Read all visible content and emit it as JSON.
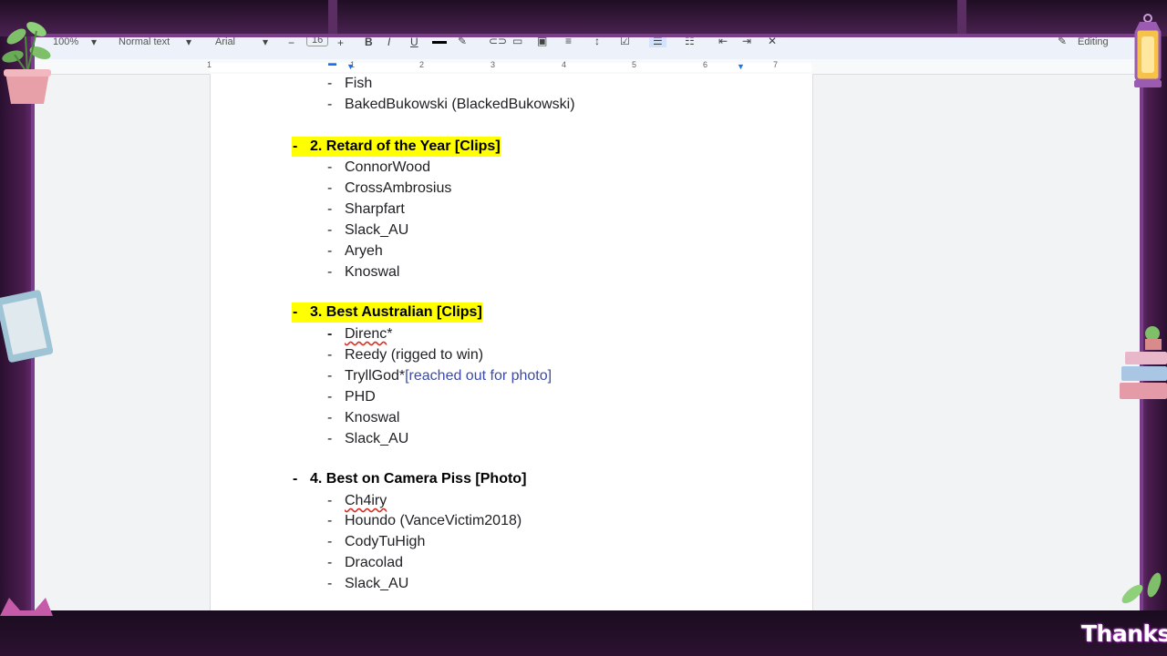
{
  "toolbar": {
    "zoom": "100%",
    "style": "Normal text",
    "font": "Arial",
    "font_size": "16",
    "mode": "Editing"
  },
  "ruler": {
    "numbers": [
      "1",
      "1",
      "2",
      "3",
      "4",
      "5",
      "6",
      "7"
    ]
  },
  "document": {
    "top_items": [
      "Fish",
      "BakedBukowski (BlackedBukowski)"
    ],
    "sections": [
      {
        "heading": "2. Retard of the Year [Clips]",
        "highlighted": true,
        "items": [
          {
            "text": "ConnorWood"
          },
          {
            "text": "CrossAmbrosius"
          },
          {
            "text": "Sharpfart"
          },
          {
            "text": "Slack_AU"
          },
          {
            "text": "Aryeh"
          },
          {
            "text": "Knoswal"
          }
        ]
      },
      {
        "heading": "3. Best Australian [Clips]",
        "highlighted": true,
        "items": [
          {
            "text": "Direnc",
            "suffix": "*",
            "misspelled": true
          },
          {
            "text": "Reedy (rigged to win)"
          },
          {
            "text": "TryllGod*",
            "note": "[reached out for photo]"
          },
          {
            "text": "PHD"
          },
          {
            "text": "Knoswal"
          },
          {
            "text": "Slack_AU"
          }
        ]
      },
      {
        "heading": "4. Best on Camera Piss [Photo]",
        "highlighted": false,
        "items": [
          {
            "text": "Ch4iry",
            "misspelled": true
          },
          {
            "text": "Houndo (VanceVictim2018)"
          },
          {
            "text": "CodyTuHigh"
          },
          {
            "text": "Dracolad"
          },
          {
            "text": "Slack_AU"
          }
        ]
      }
    ],
    "bullet": "-"
  },
  "overlay": {
    "thanks_text": "Thanks"
  },
  "colors": {
    "highlight": "#ffff00",
    "frame_purple": "#7a3d8a",
    "note_blue": "#3c4aa6"
  }
}
